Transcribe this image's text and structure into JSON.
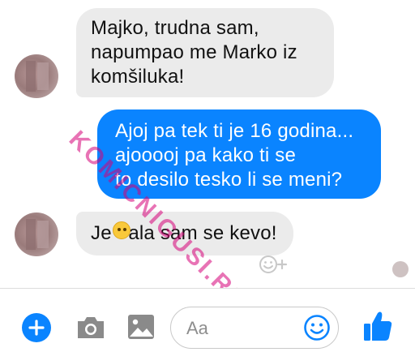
{
  "messages": [
    {
      "direction": "incoming",
      "lines": [
        "Majko, trudna sam,",
        "napumpao me Marko iz",
        "komšiluka!"
      ]
    },
    {
      "direction": "outgoing",
      "lines": [
        "Ajoj pa tek ti je 16 godina...",
        "ajooooj pa kako ti se",
        "to desilo tesko li se meni?"
      ]
    },
    {
      "direction": "incoming",
      "lines": [
        "Je   ala sam se kevo!"
      ]
    }
  ],
  "watermark": "KOMICNIGUSI.RS",
  "composer": {
    "placeholder": "Aa",
    "icons": [
      "plus-icon",
      "camera-icon",
      "image-icon",
      "emoji-icon",
      "thumbs-up-icon"
    ]
  },
  "colors": {
    "accent": "#0a84ff",
    "incoming_bubble": "#ebebeb",
    "watermark": "#d60078"
  }
}
